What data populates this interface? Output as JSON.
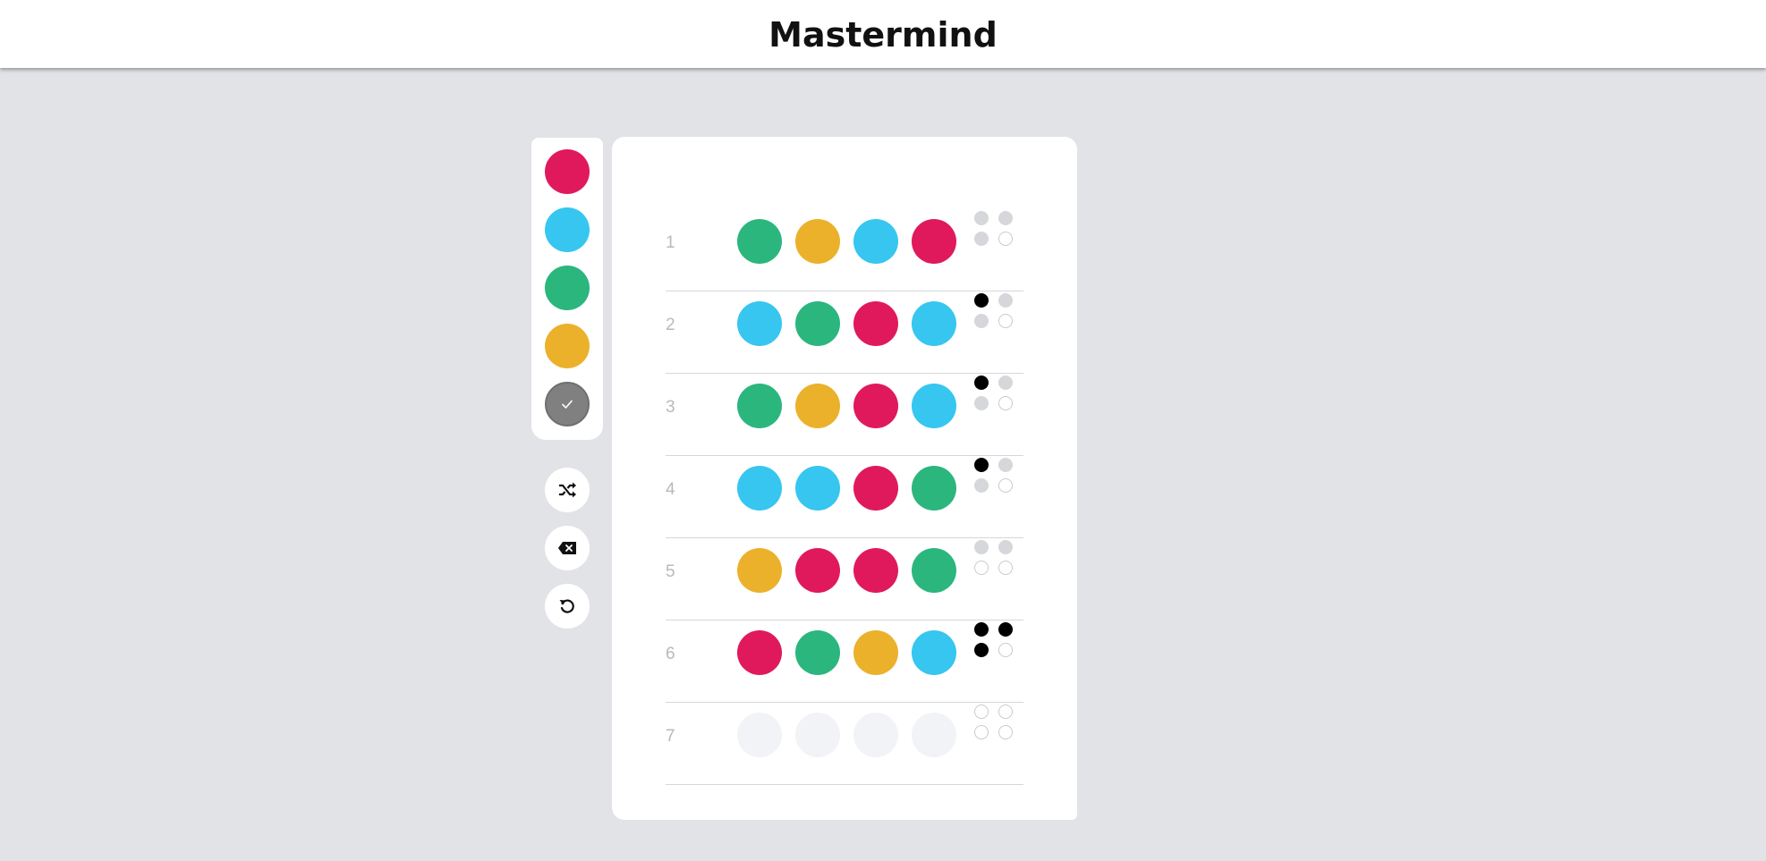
{
  "title": "Mastermind",
  "colors": {
    "red": "#e0195c",
    "blue": "#36c6f0",
    "green": "#2bb67e",
    "yellow": "#ebb12b",
    "empty": "#f2f3f7"
  },
  "palette": [
    {
      "name": "red",
      "color": "#e0195c"
    },
    {
      "name": "blue",
      "color": "#36c6f0"
    },
    {
      "name": "green",
      "color": "#2bb67e"
    },
    {
      "name": "yellow",
      "color": "#ebb12b"
    }
  ],
  "buttons": {
    "submit": "check-icon",
    "shuffle": "shuffle-icon",
    "backspace": "backspace-icon",
    "reset": "reset-icon"
  },
  "rows": [
    {
      "number": "1",
      "pegs": [
        "green",
        "yellow",
        "blue",
        "red"
      ],
      "feedback": [
        "grey",
        "grey",
        "grey",
        "empty"
      ]
    },
    {
      "number": "2",
      "pegs": [
        "blue",
        "green",
        "red",
        "blue"
      ],
      "feedback": [
        "black",
        "grey",
        "grey",
        "empty"
      ]
    },
    {
      "number": "3",
      "pegs": [
        "green",
        "yellow",
        "red",
        "blue"
      ],
      "feedback": [
        "black",
        "grey",
        "grey",
        "empty"
      ]
    },
    {
      "number": "4",
      "pegs": [
        "blue",
        "blue",
        "red",
        "green"
      ],
      "feedback": [
        "black",
        "grey",
        "grey",
        "empty"
      ]
    },
    {
      "number": "5",
      "pegs": [
        "yellow",
        "red",
        "red",
        "green"
      ],
      "feedback": [
        "grey",
        "grey",
        "empty",
        "empty"
      ]
    },
    {
      "number": "6",
      "pegs": [
        "red",
        "green",
        "yellow",
        "blue"
      ],
      "feedback": [
        "black",
        "black",
        "black",
        "empty"
      ]
    },
    {
      "number": "7",
      "pegs": [
        "empty",
        "empty",
        "empty",
        "empty"
      ],
      "feedback": [
        "empty",
        "empty",
        "empty",
        "empty"
      ]
    }
  ]
}
